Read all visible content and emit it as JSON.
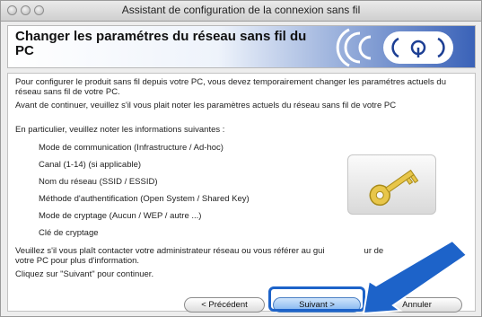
{
  "window": {
    "title": "Assistant de configuration de la connexion sans fil"
  },
  "header": {
    "title": "Changer les paramétres du réseau sans fil du PC"
  },
  "content": {
    "para1": "Pour configurer le produit sans fil depuis votre PC, vous devez temporairement changer les paramétres actuels du réseau sans fil de votre PC.",
    "para2": "Avant de continuer, veuillez s'il vous plait noter les paramètres actuels du réseau sans fil de votre PC",
    "para3": "En particulier, veuillez noter les informations suivantes :",
    "items": [
      "Mode de communication (Infrastructure / Ad-hoc)",
      "Canal (1-14) (si applicable)",
      "Nom du réseau (SSID / ESSID)",
      "Méthode d'authentification (Open System / Shared Key)",
      "Mode de cryptage (Aucun / WEP / autre ...)",
      "Clé de cryptage"
    ],
    "para4a": "Veuillez s'il vous plaît contacter votre administrateur réseau ou vous référer au gui",
    "para4b": "ur de",
    "para4c": "votre PC pour plus d'information.",
    "para5": "Cliquez sur \"Suivant\" pour continuer."
  },
  "buttons": {
    "previous": "< Précédent",
    "next": "Suivant >",
    "cancel": "Annuler"
  },
  "colors": {
    "accent": "#1d63c9",
    "banner_blue": "#3a62b8"
  },
  "icons": [
    "wireless-signal-icon",
    "key-icon",
    "pointer-arrow-icon"
  ]
}
